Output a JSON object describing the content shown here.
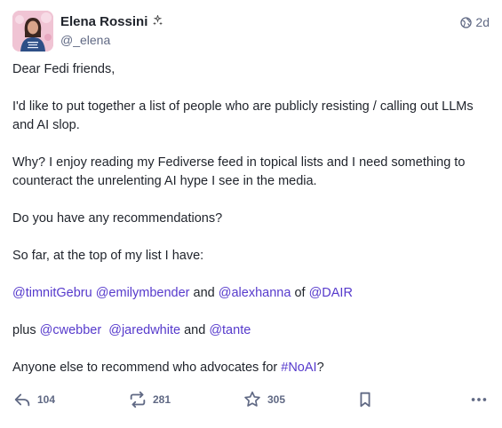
{
  "author": {
    "display_name": "Elena Rossini",
    "badge_icon": "sparkles-icon",
    "handle": "@_elena"
  },
  "meta": {
    "visibility_icon": "globe-icon",
    "time": "2d"
  },
  "content": {
    "greeting": "Dear Fedi friends,",
    "p1": "I'd like to put together a list of people who are publicly resisting / calling out LLMs and AI slop.",
    "p2": "Why? I enjoy reading my Fediverse feed in topical lists and I need something to counteract the unrelenting AI hype I see in the media.",
    "p3": "Do you have any recommendations?",
    "p4": "So far, at the top of my list I have:",
    "line5": {
      "mention1": "@timnitGebru",
      "mention2": "@emilymbender",
      "and": "and",
      "mention3": "@alexhanna",
      "of": "of",
      "mention4": "@DAIR"
    },
    "line6": {
      "plus": "plus",
      "mention1": "@cwebber",
      "mention2": "@jaredwhite",
      "and": "and",
      "mention3": "@tante"
    },
    "line7": {
      "text": "Anyone else to recommend who advocates for",
      "hashtag": "#NoAI",
      "end": "?"
    }
  },
  "actions": {
    "reply_count": "104",
    "boost_count": "281",
    "favourite_count": "305"
  },
  "colors": {
    "link": "#563acc",
    "muted": "#606984",
    "text": "#1f232b"
  }
}
